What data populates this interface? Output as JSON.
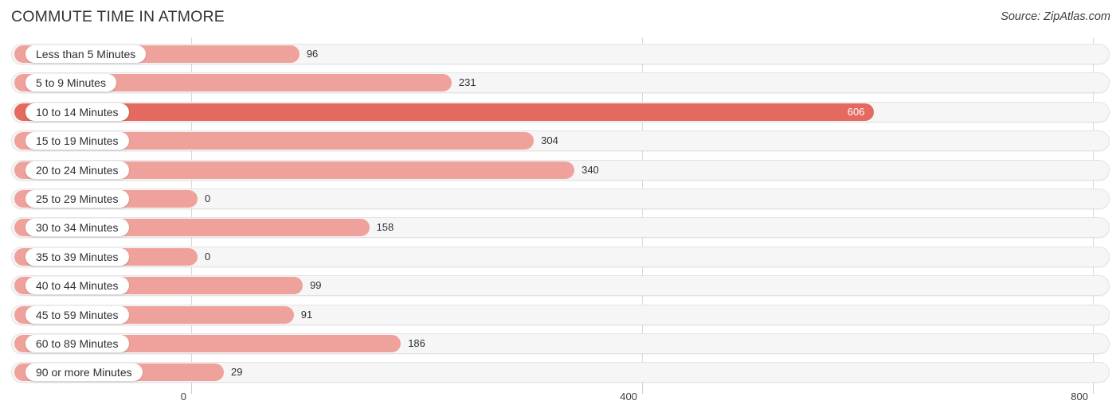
{
  "header": {
    "title": "COMMUTE TIME IN ATMORE",
    "source": "Source: ZipAtlas.com"
  },
  "chart_data": {
    "type": "bar",
    "orientation": "horizontal",
    "title": "COMMUTE TIME IN ATMORE",
    "xlabel": "",
    "ylabel": "",
    "xlim": [
      0,
      800
    ],
    "xticks": [
      0,
      400,
      800
    ],
    "xtick_labels": [
      "0",
      "400",
      "800"
    ],
    "grid": true,
    "legend": false,
    "categories": [
      "Less than 5 Minutes",
      "5 to 9 Minutes",
      "10 to 14 Minutes",
      "15 to 19 Minutes",
      "20 to 24 Minutes",
      "25 to 29 Minutes",
      "30 to 34 Minutes",
      "35 to 39 Minutes",
      "40 to 44 Minutes",
      "45 to 59 Minutes",
      "60 to 89 Minutes",
      "90 or more Minutes"
    ],
    "values": [
      96,
      231,
      606,
      304,
      340,
      0,
      158,
      0,
      99,
      91,
      186,
      29
    ],
    "value_labels": [
      "96",
      "231",
      "606",
      "304",
      "340",
      "0",
      "158",
      "0",
      "99",
      "91",
      "186",
      "29"
    ],
    "max_value": 606,
    "max_index": 2,
    "colors": {
      "bar": "#efa29c",
      "bar_max": "#e4695e",
      "track": "#f6f6f6",
      "track_border": "#e3e3e5",
      "gridline": "#d8d8dc",
      "label_text": "#2f3035",
      "inline_label_text": "#ffffff",
      "title_text": "#33343a"
    }
  }
}
